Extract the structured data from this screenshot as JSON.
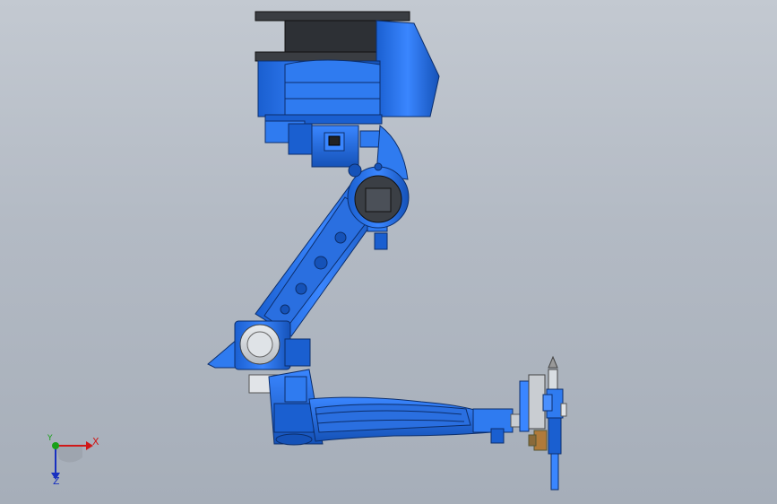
{
  "viewport": {
    "background_top": "#c3c9d1",
    "background_bottom": "#a6aeb9"
  },
  "model": {
    "primary_color": "#1f6fe8",
    "dark_color": "#333840",
    "highlight_color": "#4a90ff"
  },
  "triad": {
    "x_label": "X",
    "y_label": "Y",
    "z_label": "Z",
    "x_color": "#d01818",
    "y_color": "#18a018",
    "z_color": "#1830c0"
  }
}
